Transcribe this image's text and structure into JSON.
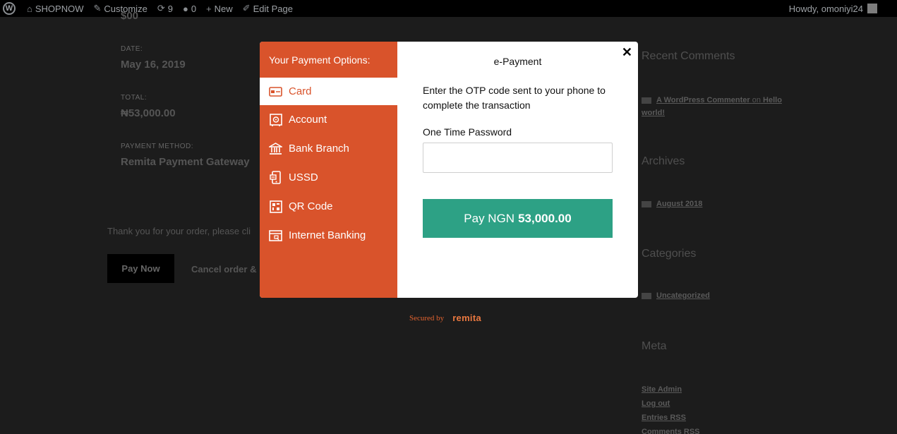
{
  "adminbar": {
    "site_name": "SHOPNOW",
    "customize": "Customize",
    "updates_count": "9",
    "comments_count": "0",
    "new_label": "New",
    "edit_page": "Edit Page",
    "howdy": "Howdy, omoniyi24"
  },
  "order": {
    "top_value": "$00",
    "date_label": "DATE:",
    "date_value": "May 16, 2019",
    "total_label": "TOTAL:",
    "total_value": "₦53,000.00",
    "method_label": "PAYMENT METHOD:",
    "method_value": "Remita Payment Gateway",
    "thanks_text": "Thank you for your order, please cli",
    "pay_now_label": "Pay Now",
    "cancel_label": "Cancel order & re"
  },
  "sidebar": {
    "recent_comments_title": "Recent Comments",
    "commenter": "A WordPress Commenter",
    "on_text": "on",
    "comment_post": "Hello world!",
    "archives_title": "Archives",
    "archive_item": "August 2018",
    "categories_title": "Categories",
    "category_item": "Uncategorized",
    "meta_title": "Meta",
    "meta_links": [
      "Site Admin",
      "Log out",
      "Entries RSS",
      "Comments RSS"
    ]
  },
  "modal": {
    "options_title": "Your Payment Options:",
    "menu": [
      {
        "label": "Card",
        "icon": "card-icon",
        "active": true
      },
      {
        "label": "Account",
        "icon": "safe-icon",
        "active": false
      },
      {
        "label": "Bank Branch",
        "icon": "bank-icon",
        "active": false
      },
      {
        "label": "USSD",
        "icon": "phone-icon",
        "active": false
      },
      {
        "label": "QR Code",
        "icon": "qr-code-icon",
        "active": false
      },
      {
        "label": "Internet Banking",
        "icon": "browser-icon",
        "active": false
      }
    ],
    "panel_title": "e-Payment",
    "close_symbol": "✕",
    "instruction": "Enter the OTP code sent to your phone to complete the transaction",
    "otp_label": "One Time Password",
    "otp_value": "",
    "pay_prefix": "Pay NGN",
    "pay_amount": "53,000.00"
  },
  "footer": {
    "secured_by": "Secured by",
    "brand": "remita"
  },
  "colors": {
    "accent_orange": "#d9532b",
    "pay_green": "#2da185"
  }
}
